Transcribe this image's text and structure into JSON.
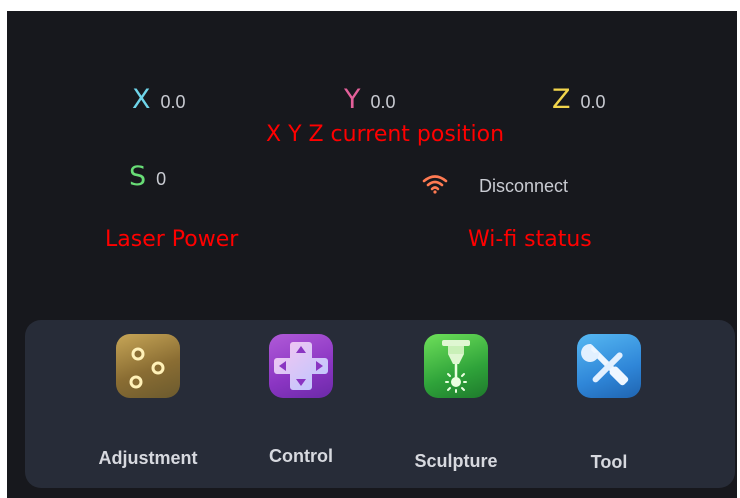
{
  "coordinates": {
    "x": {
      "label": "X",
      "value": "0.0",
      "color": "#6fd5ea"
    },
    "y": {
      "label": "Y",
      "value": "0.0",
      "color": "#e4609a"
    },
    "z": {
      "label": "Z",
      "value": "0.0",
      "color": "#f2d54c"
    }
  },
  "laser": {
    "label": "S",
    "value": "0",
    "color": "#68dc76"
  },
  "wifi": {
    "status": "Disconnect",
    "icon": "wifi-icon",
    "icon_color": "#ff7a52"
  },
  "annotations": {
    "position": "X Y Z current position",
    "laser": "Laser Power",
    "wifi": "Wi-fi status"
  },
  "apps": [
    {
      "label": "Adjustment",
      "icon": "sliders-icon"
    },
    {
      "label": "Control",
      "icon": "dpad-icon"
    },
    {
      "label": "Sculpture",
      "icon": "laser-engraver-icon"
    },
    {
      "label": "Tool",
      "icon": "tools-icon"
    }
  ]
}
